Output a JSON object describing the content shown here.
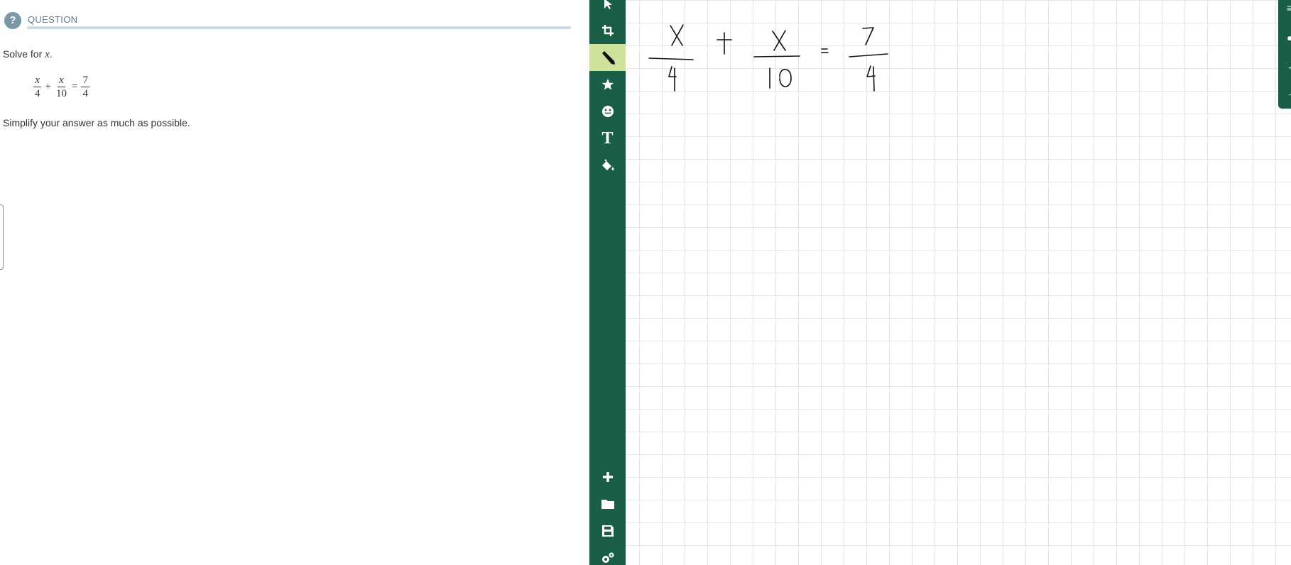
{
  "question": {
    "heading": "QUESTION",
    "help_icon": "question-circle-icon",
    "prompt_text": "Solve for ",
    "prompt_var": "x",
    "prompt_end": ".",
    "equation": {
      "term1_num": "x",
      "term1_den": "4",
      "plus": "+",
      "term2_num": "x",
      "term2_den": "10",
      "equals": "=",
      "rhs_num": "7",
      "rhs_den": "4"
    },
    "instruction": "Simplify your answer as much as possible."
  },
  "toolbar": {
    "tools": [
      {
        "name": "select",
        "icon": "cursor-arrow-icon"
      },
      {
        "name": "crop",
        "icon": "crop-icon"
      },
      {
        "name": "pencil",
        "icon": "pencil-icon",
        "active": true
      },
      {
        "name": "shapes",
        "icon": "star-icon"
      },
      {
        "name": "stickers",
        "icon": "emoji-icon"
      },
      {
        "name": "text",
        "icon": "text-icon",
        "label": "T"
      },
      {
        "name": "fill",
        "icon": "paint-bucket-icon"
      }
    ],
    "bottom_tools": [
      {
        "name": "add",
        "icon": "plus-icon"
      },
      {
        "name": "open",
        "icon": "folder-icon"
      },
      {
        "name": "save",
        "icon": "save-icon"
      },
      {
        "name": "settings",
        "icon": "gears-icon"
      }
    ],
    "colors": {
      "bar": "#1b5e48",
      "active": "#cfe29b"
    }
  },
  "whiteboard": {
    "grid_color": "#e6e6e6",
    "ink_color": "#111111",
    "handwriting": {
      "term1_num": "X",
      "term1_den": "4",
      "plus": "+",
      "term2_num": "X",
      "term2_den": "10",
      "equals": "=",
      "rhs_num": "7",
      "rhs_den": "4"
    }
  }
}
